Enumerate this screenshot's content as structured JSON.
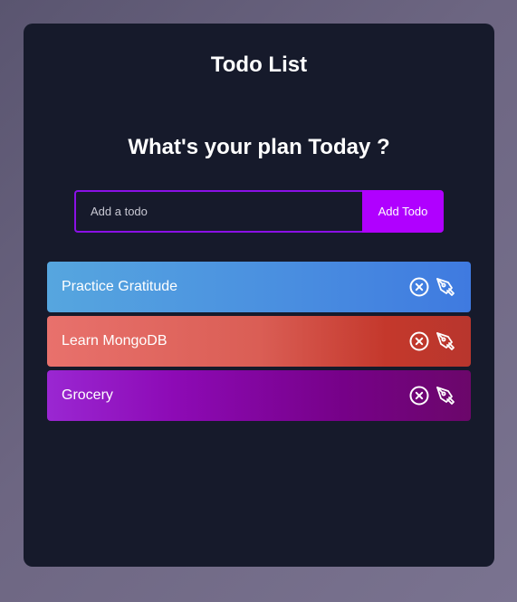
{
  "app": {
    "title": "Todo List"
  },
  "form": {
    "heading": "What's your plan Today ?",
    "input_placeholder": "Add a todo",
    "input_value": "",
    "button_label": "Add Todo"
  },
  "todos": [
    {
      "text": "Practice Gratitude",
      "delete_icon": "close-circle-icon",
      "edit_icon": "pen-nib-icon"
    },
    {
      "text": "Learn MongoDB",
      "delete_icon": "close-circle-icon",
      "edit_icon": "pen-nib-icon"
    },
    {
      "text": "Grocery",
      "delete_icon": "close-circle-icon",
      "edit_icon": "pen-nib-icon"
    }
  ],
  "colors": {
    "page_background": "#6d6682",
    "card_background": "#161a2b",
    "accent": "#b000ff",
    "input_border": "#8a10e6",
    "todo_1_gradient": [
      "#56a6df",
      "#3f7ae0"
    ],
    "todo_2_gradient": [
      "#e8716c",
      "#b8362d"
    ],
    "todo_3_gradient": [
      "#9a27d2",
      "#6b076a"
    ]
  }
}
